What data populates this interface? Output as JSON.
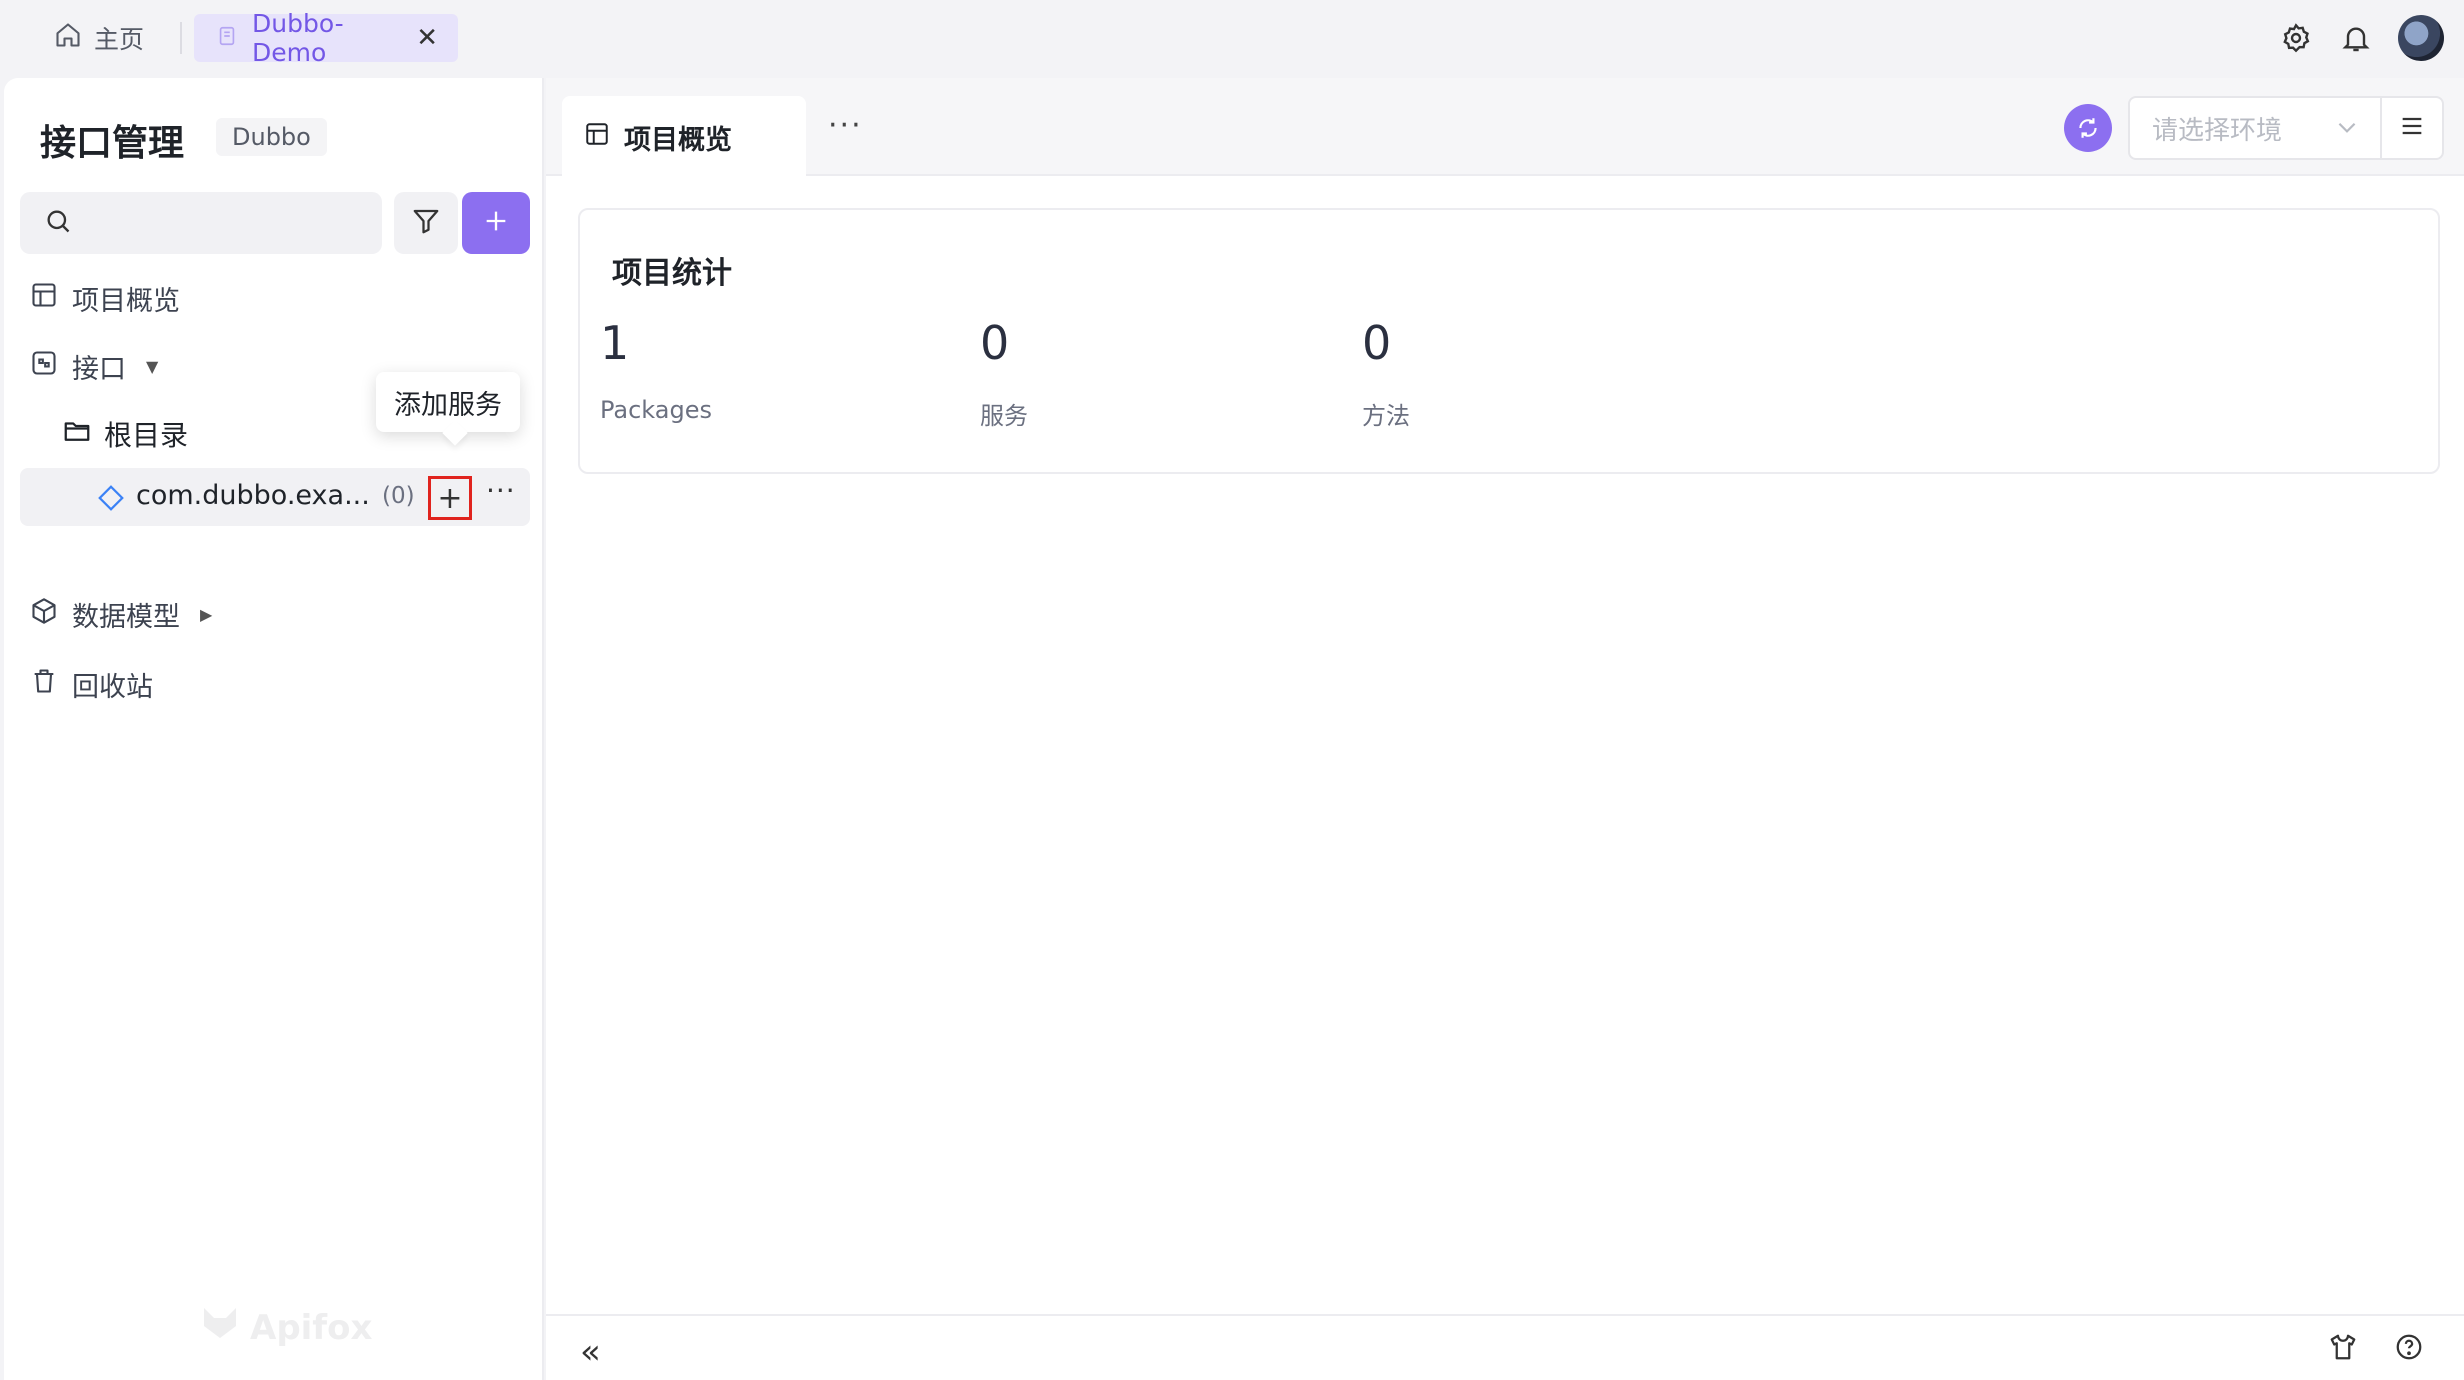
{
  "topbar": {
    "home_label": "主页",
    "project_tab_label": "Dubbo-Demo",
    "close_glyph": "✕",
    "icons": [
      "home-icon",
      "doc-icon",
      "settings-icon",
      "bell-icon",
      "avatar"
    ]
  },
  "sidebar": {
    "title": "接口管理",
    "badge": "Dubbo",
    "search_placeholder": "",
    "add_glyph": "+",
    "nav": {
      "overview": "项目概览",
      "apis": "接口",
      "root_folder": "根目录",
      "data_models": "数据模型",
      "recycle_bin": "回收站"
    },
    "service": {
      "name": "com.dubbo.exa...",
      "count": "(0)",
      "add_glyph": "+",
      "more_glyph": "···"
    },
    "tooltip": "添加服务",
    "watermark": "Apifox"
  },
  "main": {
    "tab_label": "项目概览",
    "tab_more_glyph": "···",
    "env_placeholder": "请选择环境",
    "stats": {
      "title": "项目统计",
      "items": [
        {
          "value": "1",
          "label": "Packages"
        },
        {
          "value": "0",
          "label": "服务"
        },
        {
          "value": "0",
          "label": "方法"
        }
      ]
    },
    "collapse_glyph": "«"
  },
  "colors": {
    "accent": "#8c6ff0",
    "accent_text": "#7357e6",
    "tab_highlight": "#e7e3fb",
    "highlight_border": "#e0231e"
  }
}
